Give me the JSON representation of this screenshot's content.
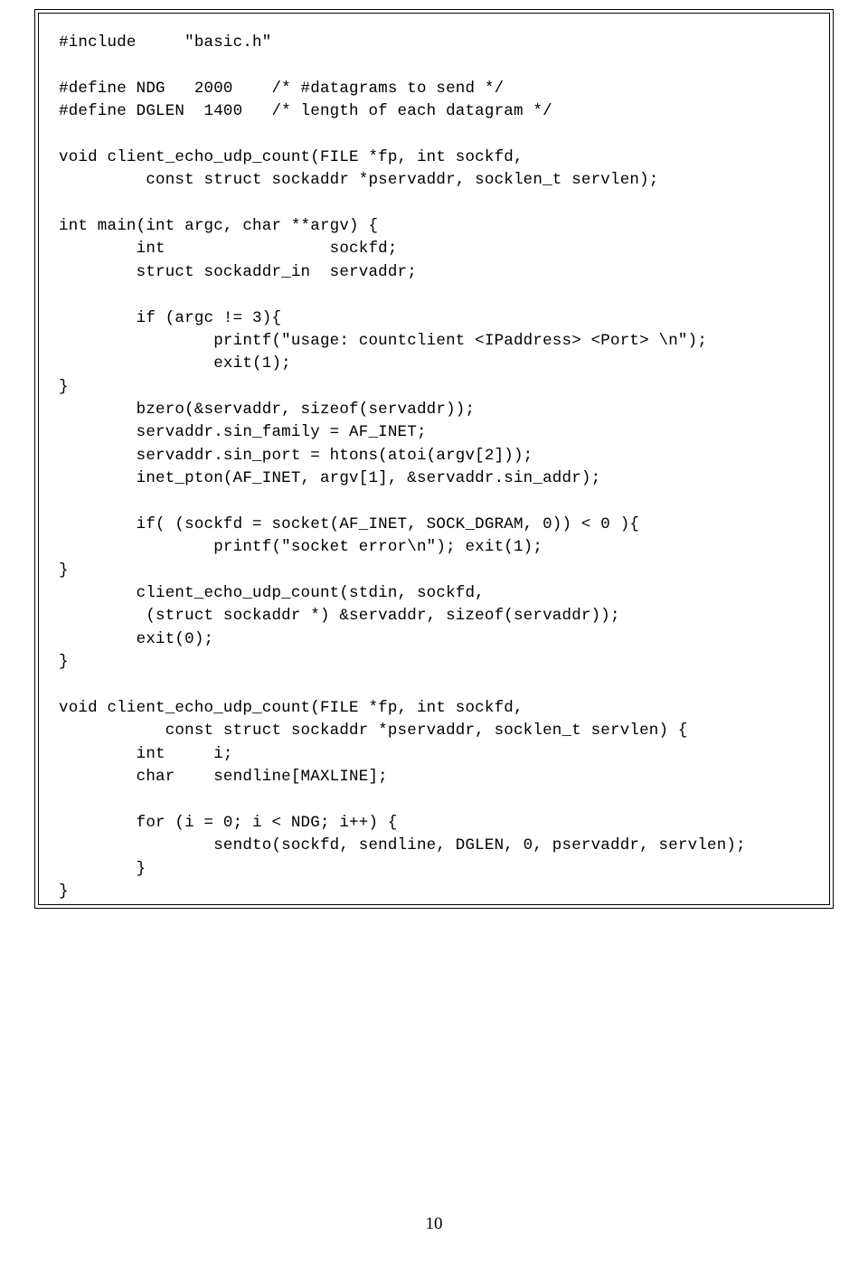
{
  "code": {
    "lines": [
      "#include     \"basic.h\"",
      "",
      "#define NDG   2000    /* #datagrams to send */",
      "#define DGLEN  1400   /* length of each datagram */",
      "",
      "void client_echo_udp_count(FILE *fp, int sockfd,",
      "         const struct sockaddr *pservaddr, socklen_t servlen);",
      "",
      "int main(int argc, char **argv) {",
      "        int                 sockfd;",
      "        struct sockaddr_in  servaddr;",
      "",
      "        if (argc != 3){",
      "                printf(\"usage: countclient <IPaddress> <Port> \\n\");",
      "                exit(1);",
      "}",
      "        bzero(&servaddr, sizeof(servaddr));",
      "        servaddr.sin_family = AF_INET;",
      "        servaddr.sin_port = htons(atoi(argv[2]));",
      "        inet_pton(AF_INET, argv[1], &servaddr.sin_addr);",
      "",
      "        if( (sockfd = socket(AF_INET, SOCK_DGRAM, 0)) < 0 ){",
      "                printf(\"socket error\\n\"); exit(1);",
      "}",
      "        client_echo_udp_count(stdin, sockfd,",
      "         (struct sockaddr *) &servaddr, sizeof(servaddr));",
      "        exit(0);",
      "}",
      "",
      "void client_echo_udp_count(FILE *fp, int sockfd,",
      "           const struct sockaddr *pservaddr, socklen_t servlen) {",
      "        int     i;",
      "        char    sendline[MAXLINE];",
      "",
      "        for (i = 0; i < NDG; i++) {",
      "                sendto(sockfd, sendline, DGLEN, 0, pservaddr, servlen);",
      "        }",
      "}"
    ]
  },
  "pageNumber": "10"
}
